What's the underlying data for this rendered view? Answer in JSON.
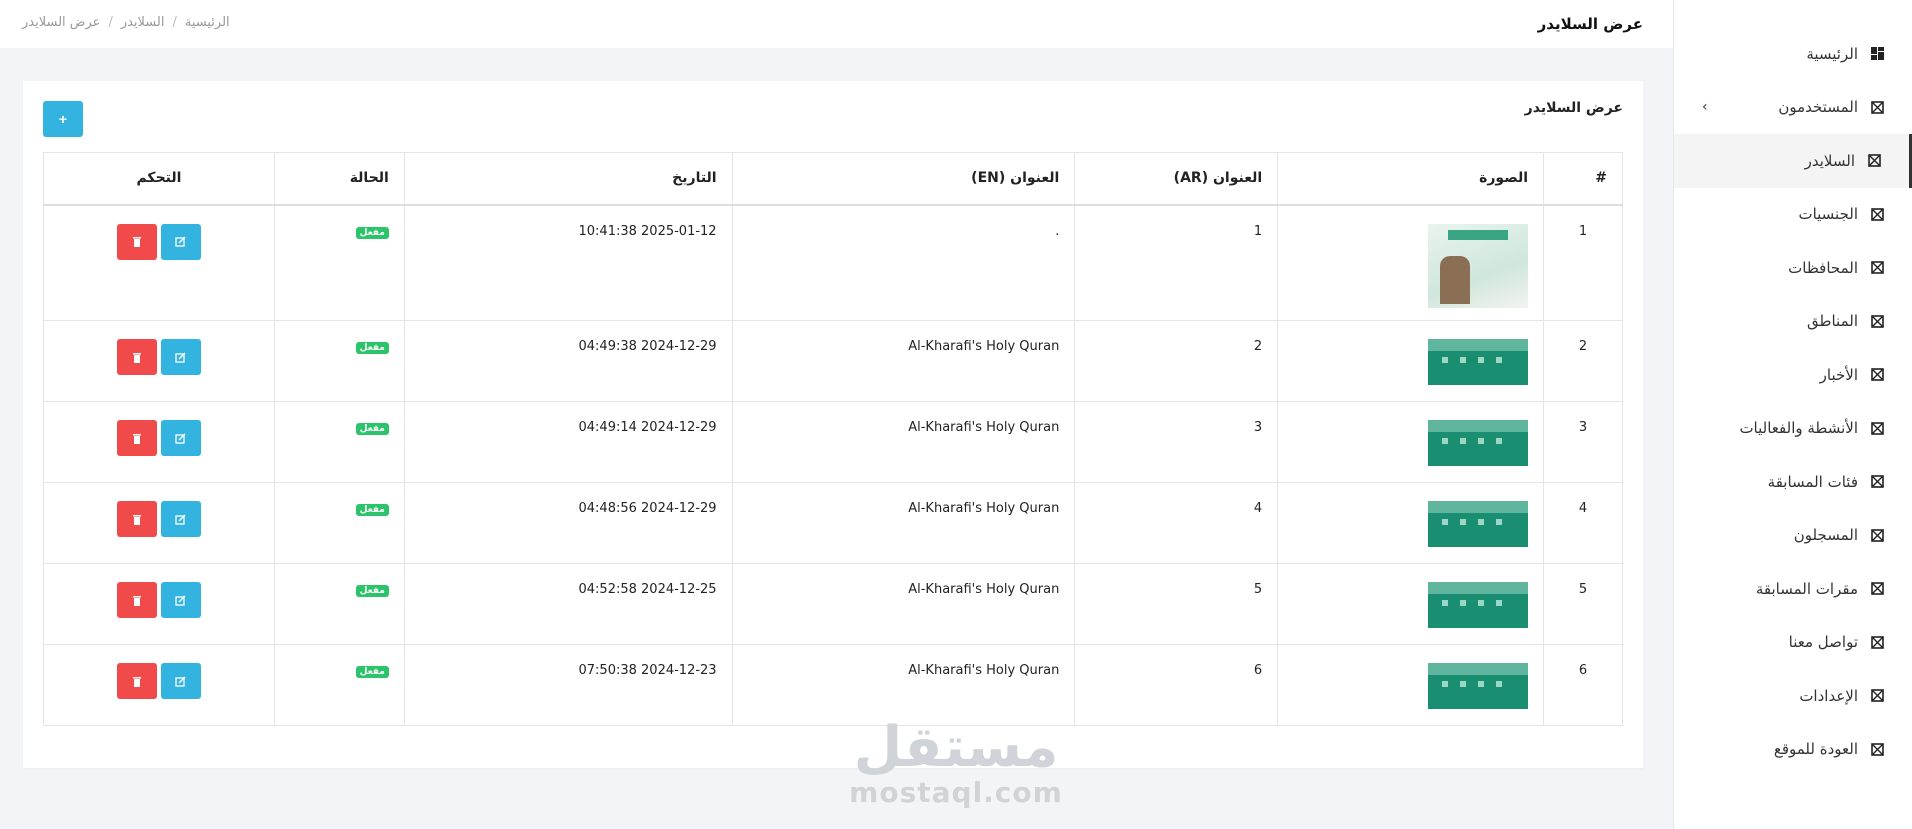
{
  "header": {
    "title": "عرض السلايدر",
    "breadcrumb": [
      "الرئيسية",
      "السلايدر",
      "عرض السلايدر"
    ]
  },
  "sidebar": {
    "items": [
      {
        "label": "الرئيسية",
        "icon": "dashboard-icon"
      },
      {
        "label": "المستخدمون",
        "icon": "grid-icon",
        "has_submenu": true
      },
      {
        "label": "السلايدر",
        "icon": "grid-icon",
        "active": true
      },
      {
        "label": "الجنسيات",
        "icon": "grid-icon"
      },
      {
        "label": "المحافظات",
        "icon": "grid-icon"
      },
      {
        "label": "المناطق",
        "icon": "grid-icon"
      },
      {
        "label": "الأخبار",
        "icon": "grid-icon"
      },
      {
        "label": "الأنشطة والفعاليات",
        "icon": "grid-icon"
      },
      {
        "label": "فئات المسابقة",
        "icon": "grid-icon"
      },
      {
        "label": "المسجلون",
        "icon": "grid-icon"
      },
      {
        "label": "مقرات المسابقة",
        "icon": "grid-icon"
      },
      {
        "label": "تواصل معنا",
        "icon": "grid-icon"
      },
      {
        "label": "الإعدادات",
        "icon": "grid-icon"
      },
      {
        "label": "العودة للموقع",
        "icon": "grid-icon"
      }
    ]
  },
  "card": {
    "title": "عرض السلايدر",
    "add_label": "+"
  },
  "table": {
    "headers": {
      "num": "#",
      "image": "الصورة",
      "title_ar": "العنوان (AR)",
      "title_en": "العنوان (EN)",
      "date": "التاريخ",
      "status": "الحالة",
      "control": "التحكم"
    },
    "rows": [
      {
        "num": "1",
        "title_ar": "1",
        "title_en": ".",
        "date": "2025-01-12 10:41:38",
        "status": "مفعل"
      },
      {
        "num": "2",
        "title_ar": "2",
        "title_en": "Al-Kharafi's Holy Quran",
        "date": "2024-12-29 04:49:38",
        "status": "مفعل"
      },
      {
        "num": "3",
        "title_ar": "3",
        "title_en": "Al-Kharafi's Holy Quran",
        "date": "2024-12-29 04:49:14",
        "status": "مفعل"
      },
      {
        "num": "4",
        "title_ar": "4",
        "title_en": "Al-Kharafi's Holy Quran",
        "date": "2024-12-29 04:48:56",
        "status": "مفعل"
      },
      {
        "num": "5",
        "title_ar": "5",
        "title_en": "Al-Kharafi's Holy Quran",
        "date": "2024-12-25 04:52:58",
        "status": "مفعل"
      },
      {
        "num": "6",
        "title_ar": "6",
        "title_en": "Al-Kharafi's Holy Quran",
        "date": "2024-12-23 07:50:38",
        "status": "مفعل"
      }
    ]
  },
  "watermark": {
    "arabic": "مستقل",
    "latin": "mostaql.com"
  },
  "colors": {
    "info": "#33b4e0",
    "danger": "#f04a4a",
    "success": "#2cc46a"
  }
}
